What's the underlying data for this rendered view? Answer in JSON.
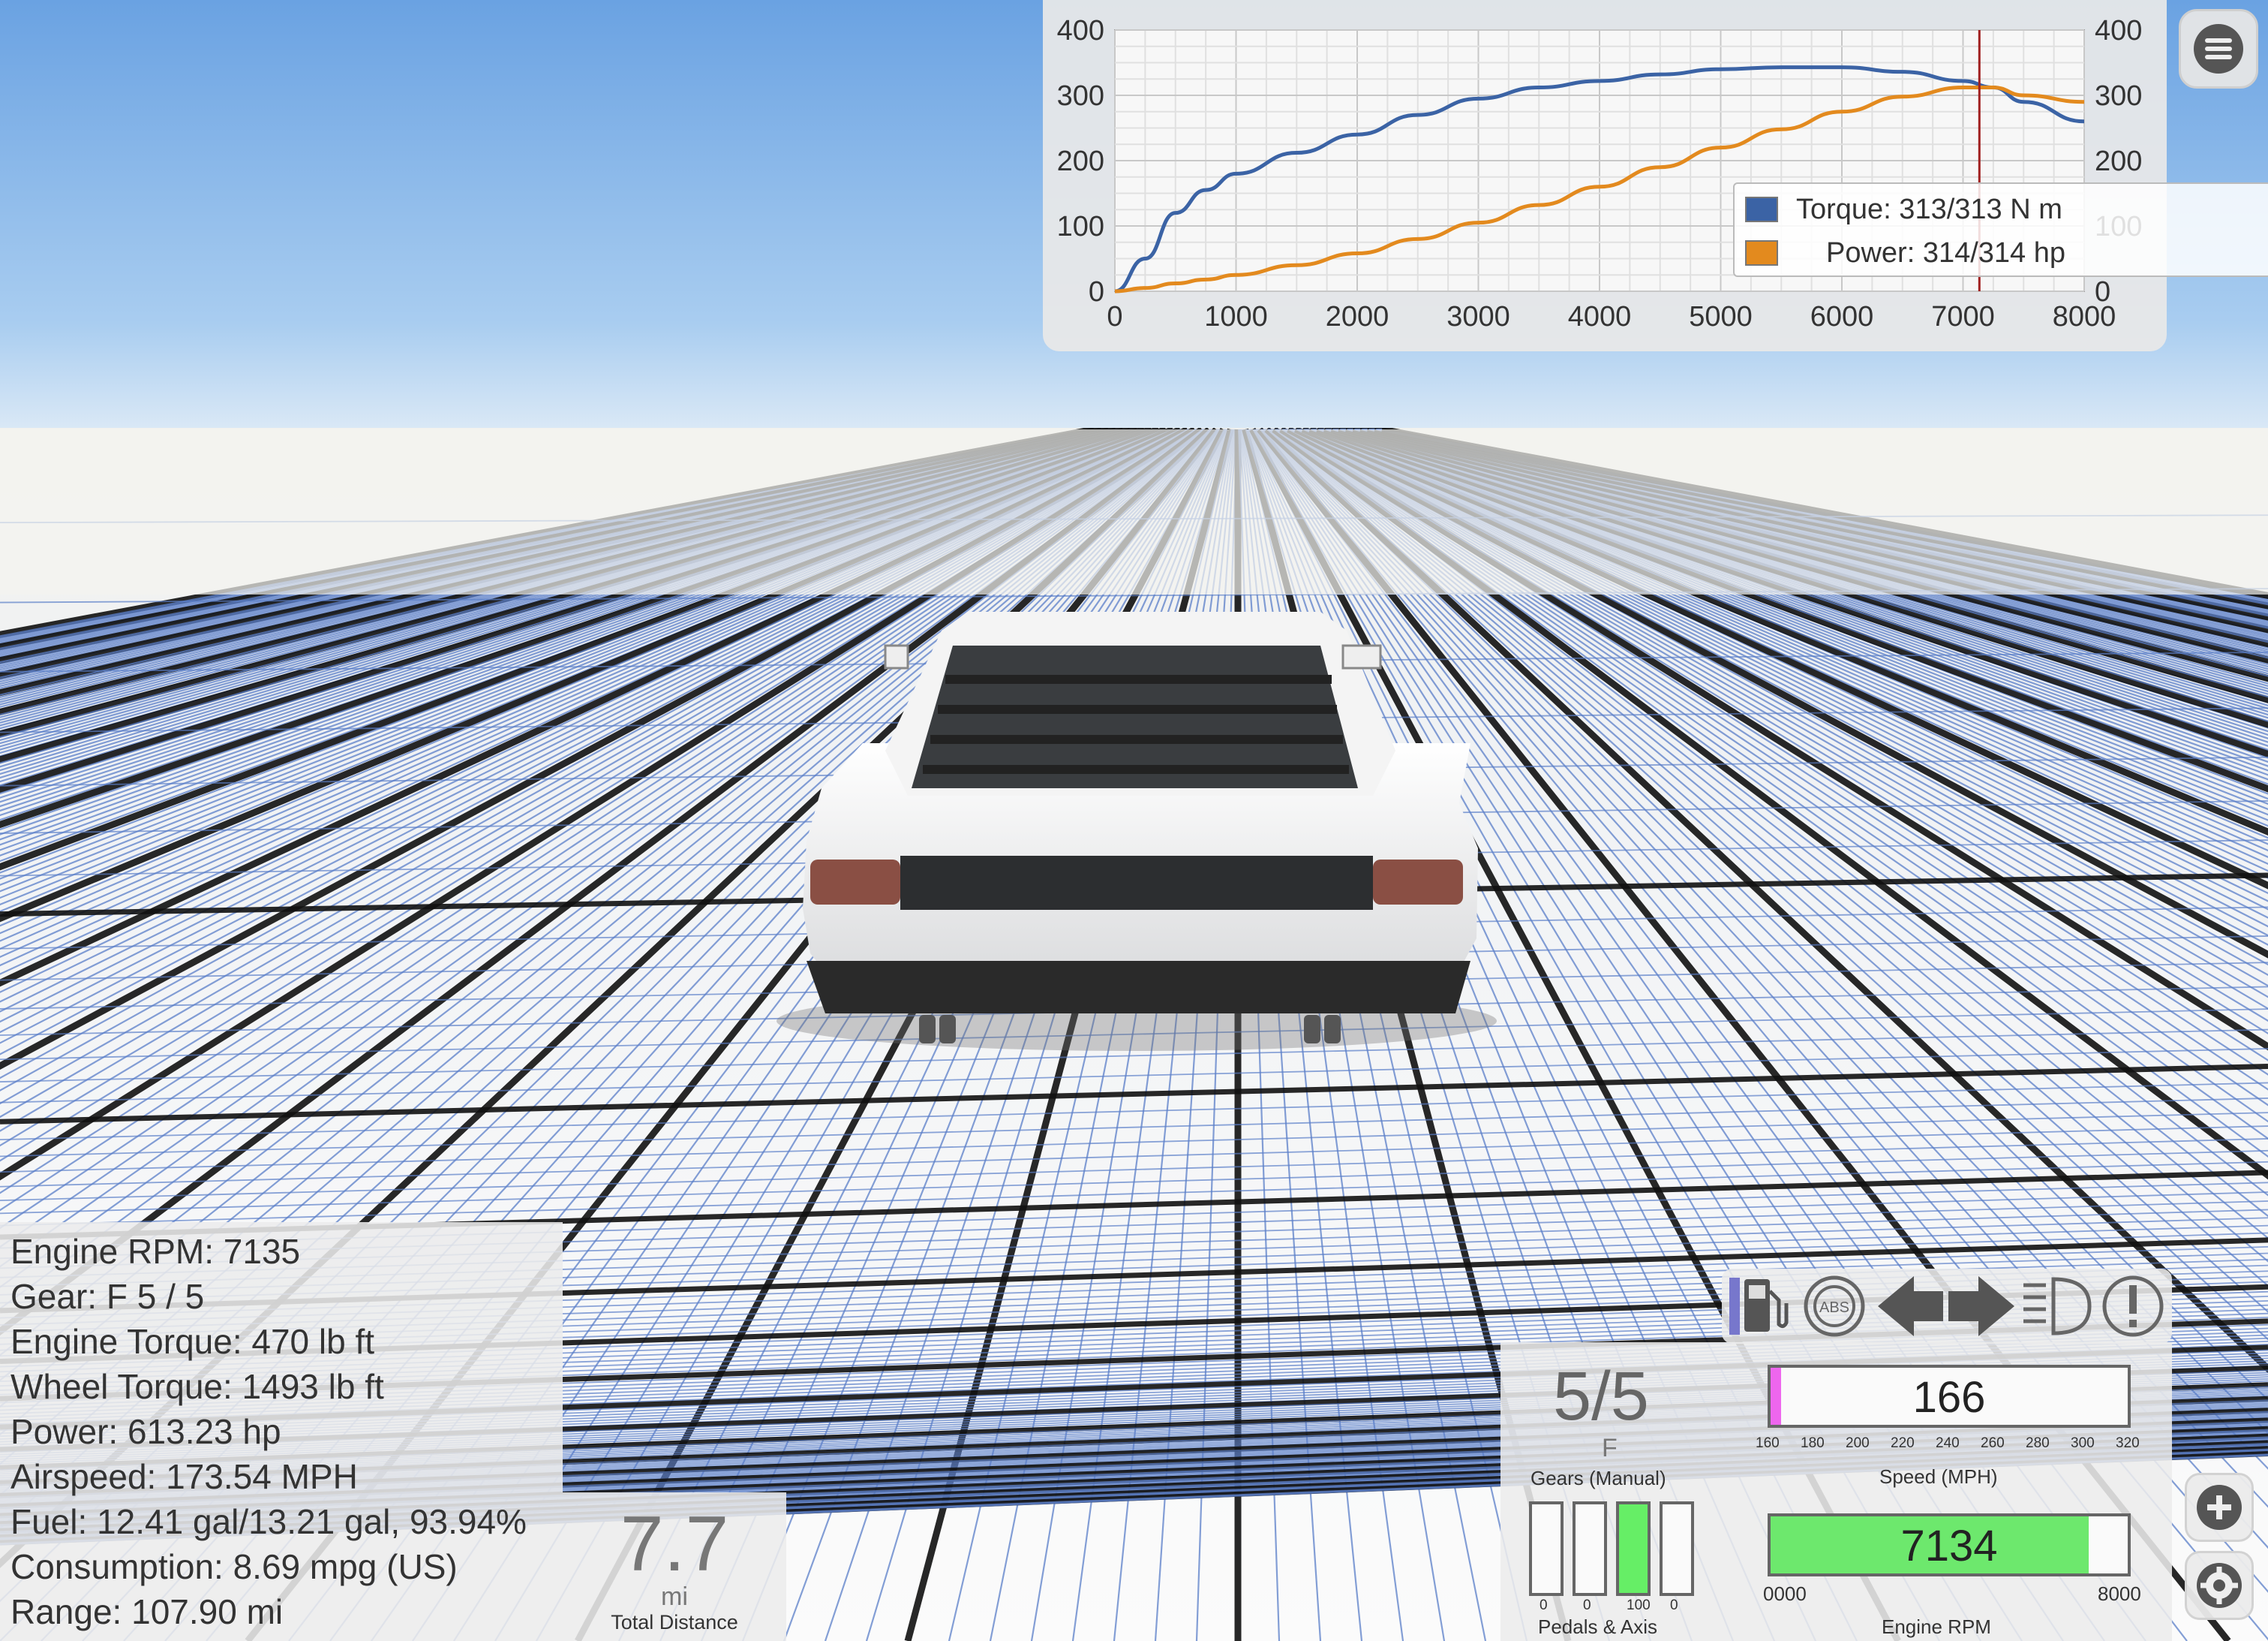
{
  "graph": {
    "y_left_ticks": [
      "400",
      "300",
      "200",
      "100",
      "0"
    ],
    "y_right_ticks": [
      "400",
      "300",
      "200",
      "100",
      "0"
    ],
    "x_ticks": [
      "0",
      "1000",
      "2000",
      "3000",
      "4000",
      "5000",
      "6000",
      "7000",
      "8000"
    ],
    "legend": [
      {
        "label": "Torque: 313/313 N m",
        "color": "#3b63a5"
      },
      {
        "label": "Power: 314/314 hp",
        "color": "#e38a1e"
      }
    ],
    "marker_color": "#a02020"
  },
  "chart_data": {
    "type": "line",
    "x": [
      0,
      250,
      500,
      750,
      1000,
      1500,
      2000,
      2500,
      3000,
      3500,
      4000,
      4500,
      5000,
      5500,
      6000,
      6500,
      7000,
      7250,
      7500,
      8000
    ],
    "series": [
      {
        "name": "Torque: 313/313 N m",
        "values": [
          0,
          50,
          120,
          155,
          180,
          212,
          240,
          270,
          295,
          312,
          322,
          332,
          340,
          343,
          343,
          336,
          322,
          312,
          290,
          260
        ]
      },
      {
        "name": "Power: 314/314 hp",
        "values": [
          0,
          5,
          12,
          18,
          25,
          40,
          58,
          80,
          105,
          132,
          160,
          190,
          220,
          248,
          275,
          298,
          312,
          312,
          300,
          290
        ]
      }
    ],
    "xlim": [
      0,
      8000
    ],
    "ylim": [
      0,
      400
    ],
    "grid": true,
    "legend_position": "bottom-right",
    "current_rpm_marker": 7135
  },
  "info": {
    "lines": [
      "Engine RPM: 7135",
      "Gear: F 5 / 5",
      "Engine Torque: 470 lb ft",
      "Wheel Torque: 1493 lb ft",
      "Power: 613.23 hp",
      "Airspeed: 173.54 MPH",
      "Fuel: 12.41 gal/13.21 gal, 93.94%",
      "Consumption: 8.69 mpg (US)",
      "Range: 107.90 mi"
    ]
  },
  "distance": {
    "value": "7.7",
    "unit": "mi",
    "label": "Total Distance"
  },
  "gears": {
    "value": "5/5",
    "mode": "F",
    "label": "Gears (Manual)"
  },
  "speed": {
    "value": "166",
    "label": "Speed (MPH)",
    "ticks": [
      "160",
      "180",
      "200",
      "220",
      "240",
      "260",
      "280",
      "300",
      "320"
    ],
    "fill_fraction": 0.03,
    "fill_color": "#ee66ee"
  },
  "pedals": {
    "label": "Pedals & Axis",
    "values": [
      "0",
      "0",
      "100",
      "0"
    ],
    "levels": [
      0,
      0,
      100,
      0
    ],
    "fill_color": "#66ee66"
  },
  "rpm": {
    "value": "7134",
    "label": "Engine RPM",
    "min_label": "0000",
    "max_label": "8000",
    "fill_fraction": 0.8918,
    "fill_color": "#6de86d"
  },
  "icons": [
    "fuel-icon",
    "abs-icon",
    "turn-left-icon",
    "turn-right-icon",
    "headlight-icon",
    "warning-icon",
    "menu-icon",
    "zoom-in-icon",
    "settings-icon"
  ]
}
